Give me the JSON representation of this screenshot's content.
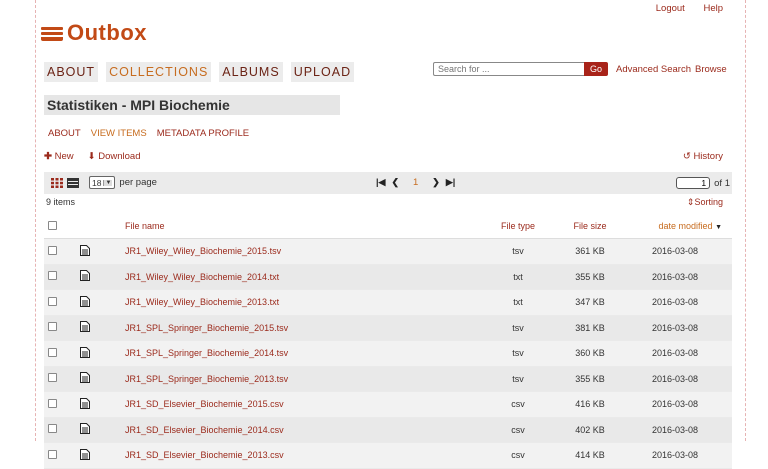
{
  "header": {
    "logout": "Logout",
    "help": "Help",
    "logo_text": "Outbox"
  },
  "nav": [
    "ABOUT",
    "COLLECTIONS",
    "ALBUMS",
    "UPLOAD"
  ],
  "search": {
    "placeholder": "Search for ...",
    "go": "Go",
    "advanced": "Advanced Search",
    "browse": "Browse"
  },
  "collection": {
    "title": "Statistiken - MPI Biochemie",
    "tabs": [
      "ABOUT",
      "VIEW ITEMS",
      "METADATA PROFILE"
    ],
    "new": "New",
    "download": "Download",
    "history": "History"
  },
  "toolbar": {
    "per_page_value": "18",
    "per_page_label": "per page",
    "current_page": "1",
    "page_input": "1",
    "of_pages": "of 1"
  },
  "list": {
    "count": "9 items",
    "sorting": "Sorting",
    "columns": {
      "name": "File name",
      "type": "File type",
      "size": "File size",
      "date": "date modified"
    },
    "rows": [
      {
        "name": "JR1_Wiley_Wiley_Biochemie_2015.tsv",
        "type": "tsv",
        "size": "361 KB",
        "date": "2016-03-08"
      },
      {
        "name": "JR1_Wiley_Wiley_Biochemie_2014.txt",
        "type": "txt",
        "size": "355 KB",
        "date": "2016-03-08"
      },
      {
        "name": "JR1_Wiley_Wiley_Biochemie_2013.txt",
        "type": "txt",
        "size": "347 KB",
        "date": "2016-03-08"
      },
      {
        "name": "JR1_SPL_Springer_Biochemie_2015.tsv",
        "type": "tsv",
        "size": "381 KB",
        "date": "2016-03-08"
      },
      {
        "name": "JR1_SPL_Springer_Biochemie_2014.tsv",
        "type": "tsv",
        "size": "360 KB",
        "date": "2016-03-08"
      },
      {
        "name": "JR1_SPL_Springer_Biochemie_2013.tsv",
        "type": "tsv",
        "size": "355 KB",
        "date": "2016-03-08"
      },
      {
        "name": "JR1_SD_Elsevier_Biochemie_2015.csv",
        "type": "csv",
        "size": "416 KB",
        "date": "2016-03-08"
      },
      {
        "name": "JR1_SD_Elsevier_Biochemie_2014.csv",
        "type": "csv",
        "size": "402 KB",
        "date": "2016-03-08"
      },
      {
        "name": "JR1_SD_Elsevier_Biochemie_2013.csv",
        "type": "csv",
        "size": "414 KB",
        "date": "2016-03-08"
      }
    ]
  },
  "colors": {
    "accent": "#c76c1f",
    "link": "#9b2a1c",
    "brand": "#c24a16"
  }
}
